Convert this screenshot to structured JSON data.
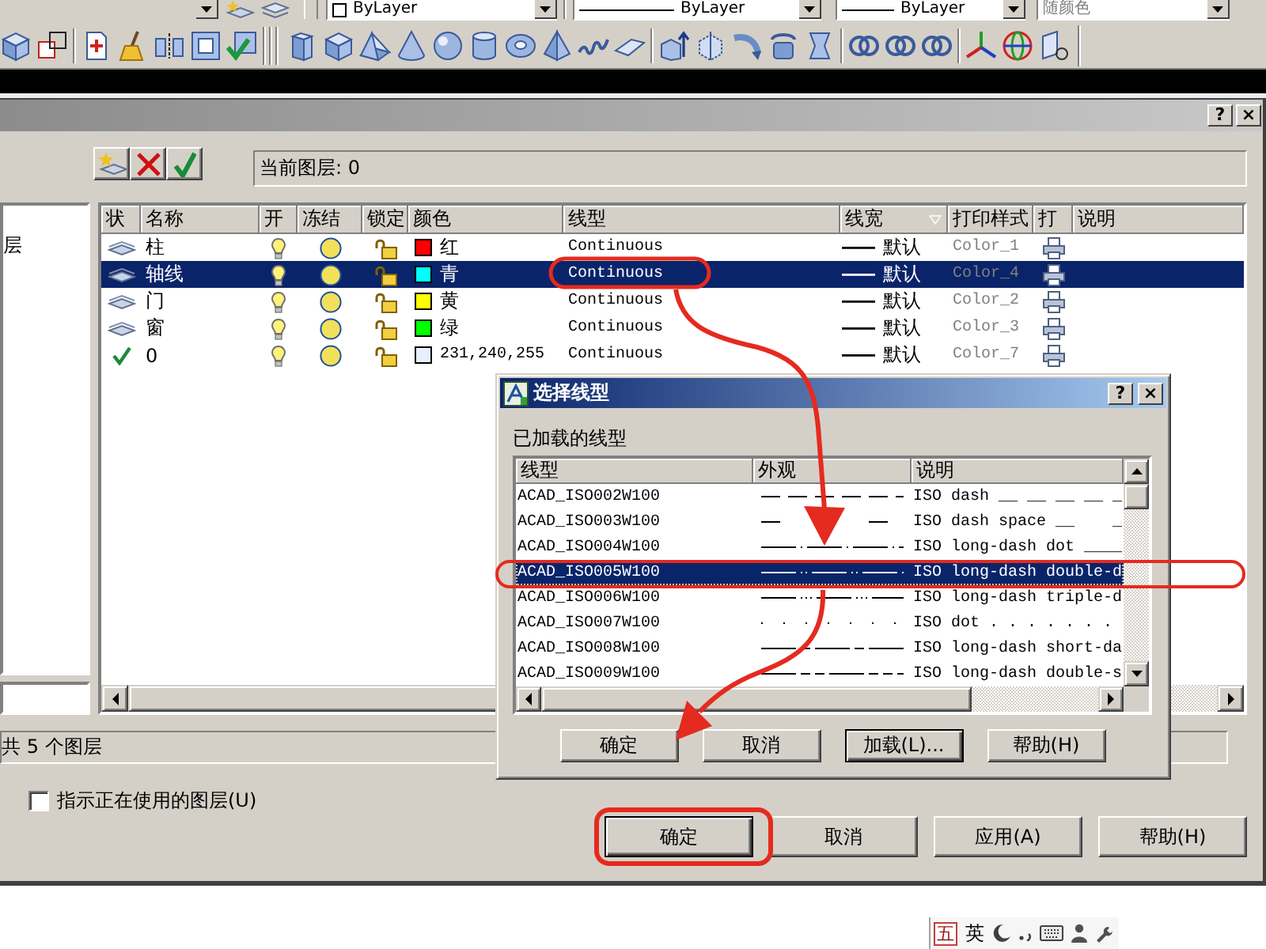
{
  "toolbar": {
    "dropdowns": [
      {
        "kind": "swatch",
        "value": "ByLayer",
        "disabled": false
      },
      {
        "kind": "line",
        "value": "ByLayer",
        "disabled": false
      },
      {
        "kind": "line",
        "value": "ByLayer",
        "disabled": false
      },
      {
        "kind": "plain",
        "value": "随颜色",
        "disabled": true
      }
    ]
  },
  "layer_dialog": {
    "title_buttons": [
      "?",
      "×"
    ],
    "current_layer": "当前图层: 0",
    "tree": [
      {
        "label": "层"
      }
    ],
    "columns": [
      {
        "label": "状",
        "sorted": false
      },
      {
        "label": "名称",
        "sorted": false
      },
      {
        "label": "开",
        "sorted": false
      },
      {
        "label": "冻结",
        "sorted": false
      },
      {
        "label": "锁定",
        "sorted": false
      },
      {
        "label": "颜色",
        "sorted": false
      },
      {
        "label": "线型",
        "sorted": false
      },
      {
        "label": "线宽",
        "sorted": true
      },
      {
        "label": "打印样式",
        "sorted": false
      },
      {
        "label": "打",
        "sorted": false
      },
      {
        "label": "说明",
        "sorted": false
      }
    ],
    "layers": [
      {
        "name": "柱",
        "current": false,
        "selected": false,
        "on": true,
        "frozen": false,
        "locked": false,
        "color": "#ff0000",
        "color_name": "红",
        "linetype": "Continuous",
        "lineweight": "默认",
        "plot_style": "Color_1"
      },
      {
        "name": "轴线",
        "current": false,
        "selected": true,
        "on": true,
        "frozen": false,
        "locked": false,
        "color": "#00ffff",
        "color_name": "青",
        "linetype": "Continuous",
        "lineweight": "默认",
        "plot_style": "Color_4"
      },
      {
        "name": "门",
        "current": false,
        "selected": false,
        "on": true,
        "frozen": false,
        "locked": false,
        "color": "#ffff00",
        "color_name": "黄",
        "linetype": "Continuous",
        "lineweight": "默认",
        "plot_style": "Color_2"
      },
      {
        "name": "窗",
        "current": false,
        "selected": false,
        "on": true,
        "frozen": false,
        "locked": false,
        "color": "#00ff00",
        "color_name": "绿",
        "linetype": "Continuous",
        "lineweight": "默认",
        "plot_style": "Color_3"
      },
      {
        "name": "0",
        "current": true,
        "selected": false,
        "on": true,
        "frozen": false,
        "locked": false,
        "color": "#e7f0ff",
        "color_name": "231,240,255",
        "linetype": "Continuous",
        "lineweight": "默认",
        "plot_style": "Color_7"
      }
    ],
    "layer_count": "共 5 个图层",
    "show_in_use": {
      "label": "指示正在使用的图层(U)",
      "checked": false
    },
    "buttons": [
      {
        "label": "确定",
        "default": true
      },
      {
        "label": "取消",
        "default": false
      },
      {
        "label": "应用(A)",
        "default": false
      },
      {
        "label": "帮助(H)",
        "default": false
      }
    ]
  },
  "linetype_dialog": {
    "title": "选择线型",
    "title_buttons": [
      "?",
      "×"
    ],
    "list_label": "已加载的线型",
    "columns": [
      "线型",
      "外观",
      "说明"
    ],
    "rows": [
      {
        "name": "ACAD_ISO002W100",
        "description": "ISO dash __ __ __ __ _",
        "selected": false
      },
      {
        "name": "ACAD_ISO003W100",
        "description": "ISO dash space __    _",
        "selected": false
      },
      {
        "name": "ACAD_ISO004W100",
        "description": "ISO long-dash dot ____",
        "selected": false
      },
      {
        "name": "ACAD_ISO005W100",
        "description": "ISO long-dash double-d",
        "selected": true
      },
      {
        "name": "ACAD_ISO006W100",
        "description": "ISO long-dash triple-d",
        "selected": false
      },
      {
        "name": "ACAD_ISO007W100",
        "description": "ISO dot . . . . . . .",
        "selected": false
      },
      {
        "name": "ACAD_ISO008W100",
        "description": "ISO long-dash short-da",
        "selected": false
      },
      {
        "name": "ACAD_ISO009W100",
        "description": "ISO long-dash double-s",
        "selected": false
      }
    ],
    "buttons": [
      {
        "label": "确定",
        "default": false
      },
      {
        "label": "取消",
        "default": false
      },
      {
        "label": "加载(L)...",
        "default": true
      },
      {
        "label": "帮助(H)",
        "default": false
      }
    ]
  },
  "ime_bar": {
    "mode": "五",
    "language": "英"
  }
}
